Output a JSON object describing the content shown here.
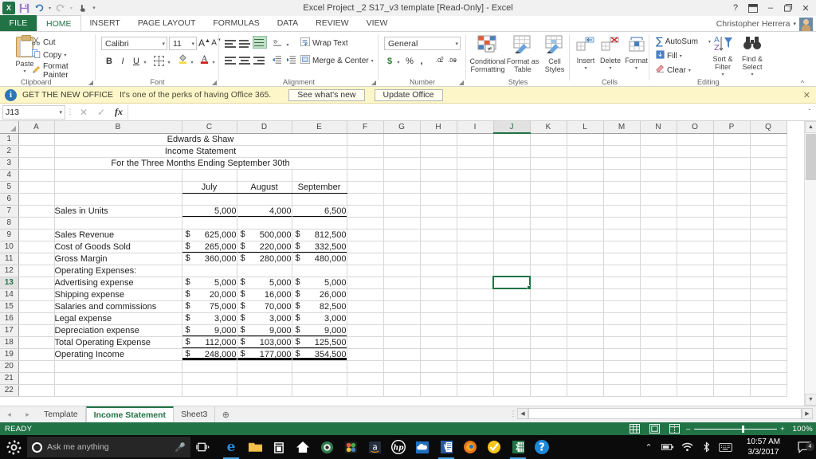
{
  "window": {
    "title": "Excel Project _2 S17_v3 template  [Read-Only] - Excel",
    "help_icon": "?",
    "ribbon_display_icon": "ribbon-display-options",
    "minimize_icon": "–",
    "restore_icon": "restore",
    "close_icon": "✕",
    "app_logo": "excel-logo"
  },
  "quick_access": {
    "save_icon": "save-icon",
    "undo_icon": "undo-icon",
    "redo_icon": "redo-icon",
    "touch_icon": "touch-mode-icon",
    "customize_icon": "customize-qat-icon"
  },
  "ribbon_tabs": [
    {
      "label": "FILE",
      "active": false,
      "is_file": true
    },
    {
      "label": "HOME",
      "active": true
    },
    {
      "label": "INSERT",
      "active": false
    },
    {
      "label": "PAGE LAYOUT",
      "active": false
    },
    {
      "label": "FORMULAS",
      "active": false
    },
    {
      "label": "DATA",
      "active": false
    },
    {
      "label": "REVIEW",
      "active": false
    },
    {
      "label": "VIEW",
      "active": false
    }
  ],
  "account": {
    "user_name": "Christopher Herrera",
    "dropdown_icon": "▾"
  },
  "ribbon": {
    "clipboard": {
      "label": "Clipboard",
      "paste": "Paste",
      "cut": "Cut",
      "copy": "Copy",
      "format_painter": "Format Painter",
      "dialog_launcher": "dialog-launcher"
    },
    "font": {
      "label": "Font",
      "font_name": "Calibri",
      "font_size": "11",
      "grow_font": "A",
      "shrink_font": "A",
      "bold": "B",
      "italic": "I",
      "underline": "U",
      "borders_icon": "borders-icon",
      "fill_color_icon": "fill-color-icon",
      "font_color_icon": "font-color-icon",
      "dialog_launcher": "dialog-launcher"
    },
    "alignment": {
      "label": "Alignment",
      "wrap_text": "Wrap Text",
      "merge_center": "Merge & Center",
      "orientation_icon": "orientation-icon",
      "decrease_indent_icon": "decrease-indent-icon",
      "increase_indent_icon": "increase-indent-icon",
      "dialog_launcher": "dialog-launcher"
    },
    "number": {
      "label": "Number",
      "format": "General",
      "accounting": "$",
      "percent": "%",
      "comma": ",",
      "increase_decimal": "increase-decimal",
      "decrease_decimal": "decrease-decimal",
      "dialog_launcher": "dialog-launcher"
    },
    "styles": {
      "label": "Styles",
      "conditional_formatting": "Conditional\nFormatting",
      "conditional_formatting_l1": "Conditional",
      "conditional_formatting_l2": "Formatting",
      "format_as_table_l1": "Format as",
      "format_as_table_l2": "Table",
      "cell_styles_l1": "Cell",
      "cell_styles_l2": "Styles"
    },
    "cells": {
      "label": "Cells",
      "insert": "Insert",
      "delete": "Delete",
      "format": "Format"
    },
    "editing": {
      "label": "Editing",
      "autosum": "AutoSum",
      "fill": "Fill",
      "clear": "Clear",
      "sort_filter_l1": "Sort &",
      "sort_filter_l2": "Filter",
      "find_select_l1": "Find &",
      "find_select_l2": "Select",
      "collapse_ribbon_icon": "collapse-ribbon-icon"
    }
  },
  "message_bar": {
    "icon": "info-icon",
    "headline": "GET THE NEW OFFICE",
    "text": "It's one of the perks of having Office 365.",
    "button_1": "See what's new",
    "button_2": "Update Office",
    "close": "✕"
  },
  "formula_bar": {
    "name_box": "J13",
    "cancel_icon": "✕",
    "enter_icon": "✓",
    "insert_function_icon": "fx",
    "formula_value": "",
    "expand_icon": "ˇ"
  },
  "grid": {
    "columns": [
      "A",
      "B",
      "C",
      "D",
      "E",
      "F",
      "G",
      "H",
      "I",
      "J",
      "K",
      "L",
      "M",
      "N",
      "O",
      "P",
      "Q"
    ],
    "selected_column": "J",
    "selected_row": 13,
    "selected_cell": "J13",
    "rows": [
      {
        "n": 1,
        "B": "Edwards & Shaw",
        "merged": true
      },
      {
        "n": 2,
        "B": "Income Statement",
        "merged": true
      },
      {
        "n": 3,
        "B": "For the Three Months Ending September 30th",
        "merged": true
      },
      {
        "n": 4,
        "B": "",
        "C": "",
        "D": "",
        "E": ""
      },
      {
        "n": 5,
        "B": "",
        "C": "July",
        "D": "August",
        "E": "September",
        "style": "header"
      },
      {
        "n": 6,
        "B": "",
        "C": "",
        "D": "",
        "E": ""
      },
      {
        "n": 7,
        "B": "Sales in Units",
        "C": "5,000",
        "D": "4,000",
        "E": "6,500",
        "style": "units"
      },
      {
        "n": 8,
        "B": "",
        "C": "",
        "D": "",
        "E": ""
      },
      {
        "n": 9,
        "B": "Sales Revenue",
        "C": "625,000",
        "D": "500,000",
        "E": "812,500",
        "cur": true
      },
      {
        "n": 10,
        "B": "Cost of Goods Sold",
        "C": "265,000",
        "D": "220,000",
        "E": "332,500",
        "cur": true,
        "style": "underline"
      },
      {
        "n": 11,
        "B": "Gross Margin",
        "C": "360,000",
        "D": "280,000",
        "E": "480,000",
        "cur": true
      },
      {
        "n": 12,
        "B": "Operating Expenses:",
        "C": "",
        "D": "",
        "E": ""
      },
      {
        "n": 13,
        "B": "Advertising expense",
        "C": "5,000",
        "D": "5,000",
        "E": "5,000",
        "cur": true,
        "indent": true
      },
      {
        "n": 14,
        "B": "Shipping expense",
        "C": "20,000",
        "D": "16,000",
        "E": "26,000",
        "cur": true,
        "indent": true
      },
      {
        "n": 15,
        "B": "Salaries and commissions",
        "C": "75,000",
        "D": "70,000",
        "E": "82,500",
        "cur": true,
        "indent": true
      },
      {
        "n": 16,
        "B": "Legal expense",
        "C": "3,000",
        "D": "3,000",
        "E": "3,000",
        "cur": true,
        "indent": true
      },
      {
        "n": 17,
        "B": "Depreciation expense",
        "C": "9,000",
        "D": "9,000",
        "E": "9,000",
        "cur": true,
        "indent": true,
        "style": "underline"
      },
      {
        "n": 18,
        "B": "Total Operating Expense",
        "C": "112,000",
        "D": "103,000",
        "E": "125,500",
        "cur": true,
        "style": "underline"
      },
      {
        "n": 19,
        "B": "Operating Income",
        "C": "248,000",
        "D": "177,000",
        "E": "354,500",
        "cur": true,
        "style": "double"
      },
      {
        "n": 20,
        "B": "",
        "C": "",
        "D": "",
        "E": ""
      },
      {
        "n": 21,
        "B": "",
        "C": "",
        "D": "",
        "E": ""
      },
      {
        "n": 22,
        "B": "",
        "C": "",
        "D": "",
        "E": ""
      }
    ],
    "currency_symbol": "$"
  },
  "sheet_tabs": {
    "prev_icon": "◂",
    "next_icon": "▸",
    "tabs": [
      {
        "label": "Template",
        "active": false
      },
      {
        "label": "Income Statement",
        "active": true
      },
      {
        "label": "Sheet3",
        "active": false
      }
    ],
    "add_sheet_icon": "⊕"
  },
  "status_bar": {
    "mode": "READY",
    "view_normal_icon": "normal-view-icon",
    "view_pagelayout_icon": "page-layout-view-icon",
    "view_pagebreak_icon": "page-break-preview-icon",
    "zoom_out": "–",
    "zoom_in": "+",
    "zoom_value": "100%"
  },
  "taskbar": {
    "start_icon": "windows-start-icon",
    "search_placeholder": "Ask me anything",
    "mic_icon": "microphone-icon",
    "task_view_icon": "task-view-icon",
    "apps": [
      {
        "name": "edge-icon",
        "glyph": "e",
        "color": "#2b8ad8",
        "running": true
      },
      {
        "name": "file-explorer-icon",
        "glyph": "▬",
        "color": "#f2c14e",
        "running": false
      },
      {
        "name": "microsoft-store-icon",
        "glyph": "⊞",
        "color": "#ffffff",
        "running": false
      },
      {
        "name": "home-icon",
        "glyph": "⌂",
        "color": "#ffffff",
        "running": false
      },
      {
        "name": "camera-app-icon",
        "glyph": "◉",
        "color": "#2e7d32",
        "running": false
      },
      {
        "name": "puzzle-app-icon",
        "glyph": "❖",
        "color": "#e05c3a",
        "running": false
      },
      {
        "name": "amazon-icon",
        "glyph": "a",
        "color": "#ffffff",
        "running": false
      },
      {
        "name": "hp-icon",
        "glyph": "hp",
        "color": "#ffffff",
        "running": false
      },
      {
        "name": "onedrive-icon",
        "glyph": "☁",
        "color": "#ffffff",
        "running": false
      },
      {
        "name": "word-icon",
        "glyph": "W",
        "color": "#ffffff",
        "running": true
      },
      {
        "name": "firefox-icon",
        "glyph": "●",
        "color": "#e8741e",
        "running": false
      },
      {
        "name": "norton-icon",
        "glyph": "✔",
        "color": "#f5c518",
        "running": false
      },
      {
        "name": "excel-icon",
        "glyph": "X",
        "color": "#ffffff",
        "running": true
      },
      {
        "name": "help-icon",
        "glyph": "?",
        "color": "#ffffff",
        "running": false
      }
    ],
    "tray": {
      "show_hidden_icon": "⌃",
      "battery_icon": "battery-icon",
      "wifi_icon": "wifi-icon",
      "bluetooth_icon": "bluetooth-icon",
      "keyboard_icon": "keyboard-icon",
      "time": "10:57 AM",
      "date": "3/3/2017",
      "action_center_icon": "action-center-icon",
      "notification_count": "4"
    }
  }
}
